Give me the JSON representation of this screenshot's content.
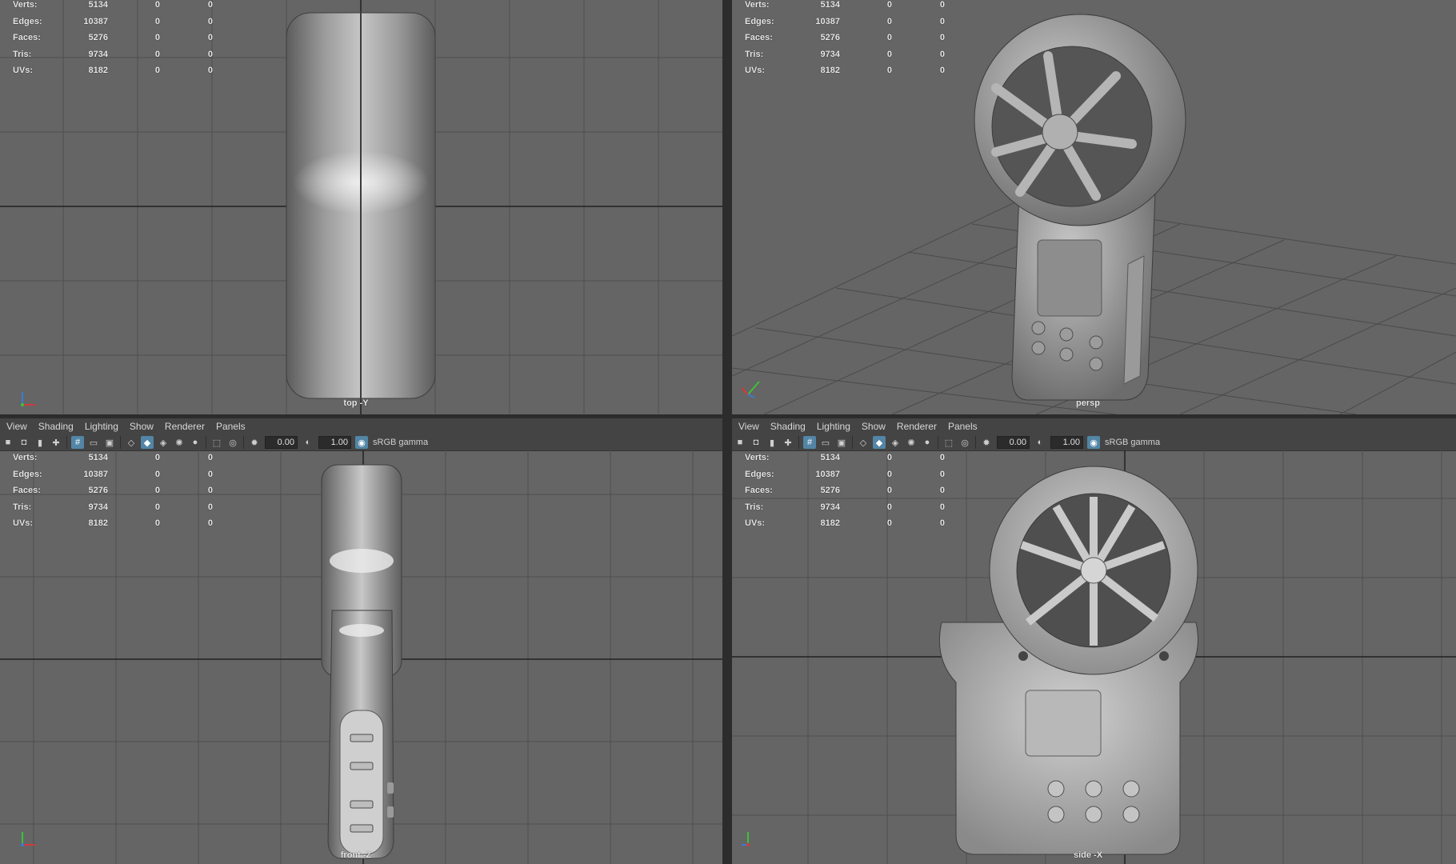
{
  "panel_menu": [
    "View",
    "Shading",
    "Lighting",
    "Show",
    "Renderer",
    "Panels"
  ],
  "toolbar": {
    "exposure": "0.00",
    "gamma": "1.00",
    "color_space": "sRGB gamma"
  },
  "hud": {
    "rows": [
      {
        "label": "Verts:",
        "v1": "5134",
        "v2": "0",
        "v3": "0"
      },
      {
        "label": "Edges:",
        "v1": "10387",
        "v2": "0",
        "v3": "0"
      },
      {
        "label": "Faces:",
        "v1": "5276",
        "v2": "0",
        "v3": "0"
      },
      {
        "label": "Tris:",
        "v1": "9734",
        "v2": "0",
        "v3": "0"
      },
      {
        "label": "UVs:",
        "v1": "8182",
        "v2": "0",
        "v3": "0"
      }
    ]
  },
  "viewports": {
    "top": {
      "camera": "top -Y"
    },
    "persp": {
      "camera": "persp"
    },
    "front": {
      "camera": "front -Z"
    },
    "side": {
      "camera": "side -X"
    }
  },
  "icons": {
    "toolbar": [
      "camera-icon",
      "camera-attr-icon",
      "bookmark-icon",
      "image-plane-icon",
      "grid-icon",
      "film-gate-icon",
      "resolution-gate-icon",
      "wireframe-icon",
      "smooth-shade-icon",
      "textured-icon",
      "lighting-icon",
      "shadows-icon",
      "isolate-icon",
      "xray-icon",
      "exposure-icon",
      "gamma-icon",
      "color-management-icon"
    ]
  },
  "colors": {
    "viewport_bg": "#656565",
    "ui_bg": "#444444",
    "active_accent": "#5285a6"
  }
}
